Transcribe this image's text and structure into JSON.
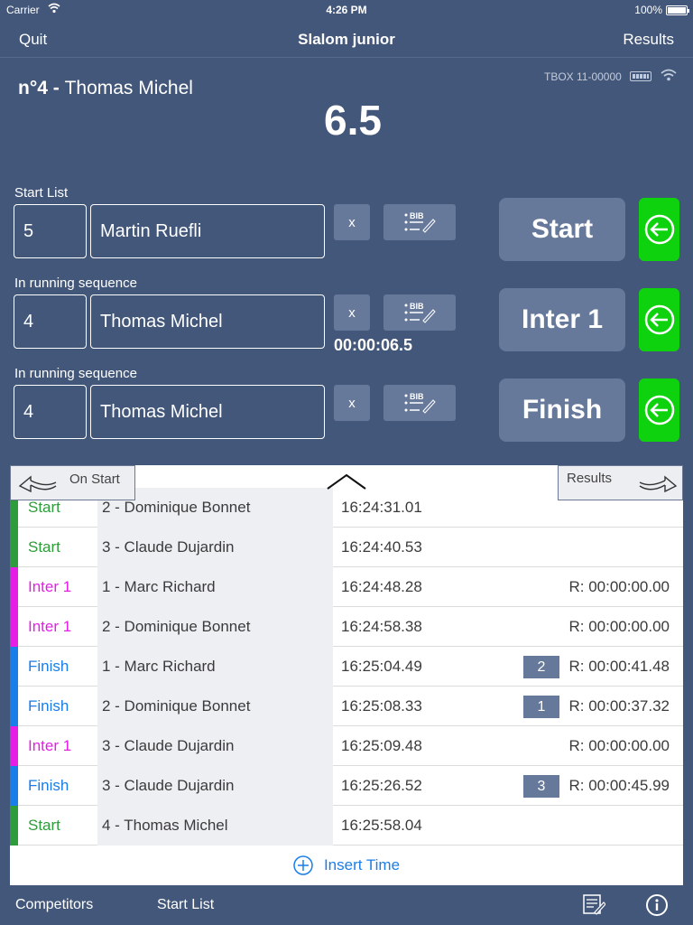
{
  "status_bar": {
    "carrier": "Carrier",
    "time": "4:26 PM",
    "battery": "100%"
  },
  "nav": {
    "left": "Quit",
    "title": "Slalom junior",
    "right": "Results"
  },
  "device": {
    "label": "TBOX 11-00000"
  },
  "current": {
    "number": "n°4 - ",
    "name": "Thomas Michel",
    "time": "6.5"
  },
  "rows": [
    {
      "label": "Start List",
      "bib": "5",
      "name": "Martin Ruefli",
      "x": "x",
      "action": "Start",
      "elapsed": ""
    },
    {
      "label": "In running sequence",
      "bib": "4",
      "name": "Thomas Michel",
      "x": "x",
      "action": "Inter 1",
      "elapsed": "00:00:06.5"
    },
    {
      "label": "In running sequence",
      "bib": "4",
      "name": "Thomas Michel",
      "x": "x",
      "action": "Finish",
      "elapsed": ""
    }
  ],
  "bib_icon_text": "BIB",
  "panel": {
    "left_tab": "On Start",
    "right_tab": "Results",
    "entries": [
      {
        "type": "Start",
        "color": "#2e9c3a",
        "competitor": "2 - Dominique Bonnet",
        "time": "16:24:31.01",
        "rank": "",
        "run": ""
      },
      {
        "type": "Start",
        "color": "#2e9c3a",
        "competitor": "3 - Claude Dujardin",
        "time": "16:24:40.53",
        "rank": "",
        "run": ""
      },
      {
        "type": "Inter 1",
        "color": "#e51ee5",
        "competitor": "1 - Marc Richard",
        "time": "16:24:48.28",
        "rank": "",
        "run": "R: 00:00:00.00"
      },
      {
        "type": "Inter 1",
        "color": "#e51ee5",
        "competitor": "2 - Dominique Bonnet",
        "time": "16:24:58.38",
        "rank": "",
        "run": "R: 00:00:00.00"
      },
      {
        "type": "Finish",
        "color": "#1a7ee8",
        "competitor": "1 - Marc Richard",
        "time": "16:25:04.49",
        "rank": "2",
        "run": "R: 00:00:41.48"
      },
      {
        "type": "Finish",
        "color": "#1a7ee8",
        "competitor": "2 - Dominique Bonnet",
        "time": "16:25:08.33",
        "rank": "1",
        "run": "R: 00:00:37.32"
      },
      {
        "type": "Inter 1",
        "color": "#e51ee5",
        "competitor": "3 - Claude Dujardin",
        "time": "16:25:09.48",
        "rank": "",
        "run": "R: 00:00:00.00"
      },
      {
        "type": "Finish",
        "color": "#1a7ee8",
        "competitor": "3 - Claude Dujardin",
        "time": "16:25:26.52",
        "rank": "3",
        "run": "R: 00:00:45.99"
      },
      {
        "type": "Start",
        "color": "#2e9c3a",
        "competitor": "4 - Thomas Michel",
        "time": "16:25:58.04",
        "rank": "",
        "run": ""
      }
    ],
    "insert_label": "Insert Time"
  },
  "bottom": {
    "competitors": "Competitors",
    "start_list": "Start List"
  },
  "colors": {
    "background": "#43577a",
    "button": "#67799b",
    "green": "#0fd20f",
    "link": "#1a7ee8"
  }
}
